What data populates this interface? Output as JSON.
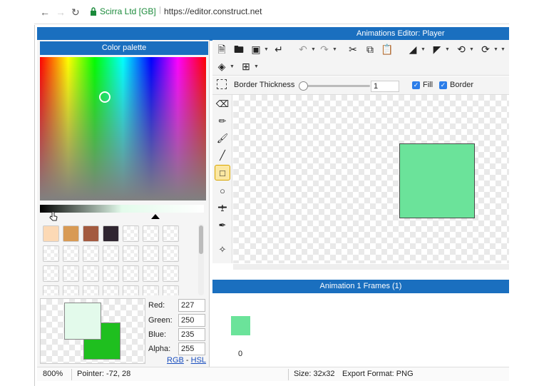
{
  "browser": {
    "site_name": "Scirra Ltd [GB]",
    "url": "https://editor.construct.net"
  },
  "editor": {
    "title": "Animations Editor: Player",
    "options": {
      "border_thickness_label": "Border Thickness",
      "border_thickness_value": "1",
      "fill_label": "Fill",
      "fill_checked": true,
      "border_label": "Border",
      "border_checked": true
    },
    "shape_color": "#6be39a"
  },
  "color_palette": {
    "title": "Color palette",
    "swatch_colors": [
      "#fcd9b5",
      "#d89a54",
      "#a35a3f",
      "#2f2530"
    ],
    "primary_color": "#e3faeb",
    "secondary_color": "#1fbf1f",
    "red_label": "Red:",
    "red_value": "227",
    "green_label": "Green:",
    "green_value": "250",
    "blue_label": "Blue:",
    "blue_value": "235",
    "alpha_label": "Alpha:",
    "alpha_value": "255",
    "rgb_link": "RGB",
    "separator": "-",
    "hsl_link": "HSL"
  },
  "frames": {
    "title": "Animation 1 Frames (1)",
    "items": [
      {
        "index": "0"
      }
    ]
  },
  "status": {
    "zoom": "800%",
    "pointer": "Pointer: -72, 28",
    "size": "Size: 32x32",
    "export_format": "Export Format: PNG"
  }
}
